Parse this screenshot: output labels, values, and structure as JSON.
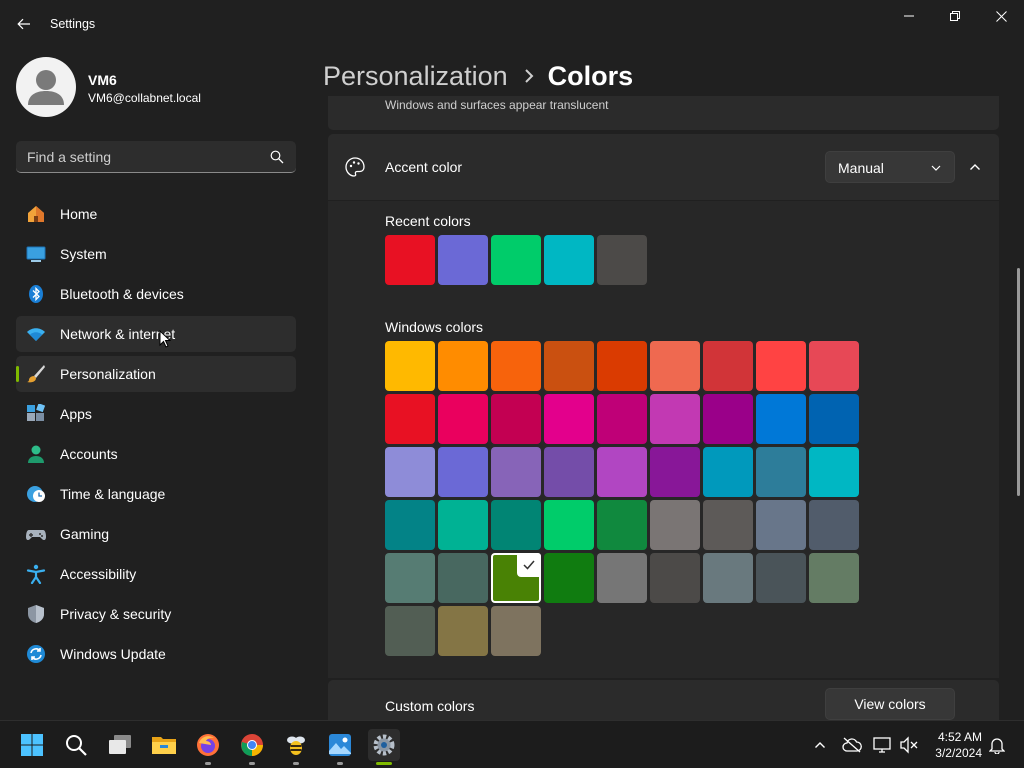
{
  "window": {
    "title": "Settings"
  },
  "user": {
    "name": "VM6",
    "email": "VM6@collabnet.local"
  },
  "search": {
    "placeholder": "Find a setting"
  },
  "nav": {
    "items": [
      {
        "label": "Home",
        "icon": "home-icon"
      },
      {
        "label": "System",
        "icon": "monitor-icon"
      },
      {
        "label": "Bluetooth & devices",
        "icon": "bluetooth-icon"
      },
      {
        "label": "Network & internet",
        "icon": "wifi-icon"
      },
      {
        "label": "Personalization",
        "icon": "paintbrush-icon"
      },
      {
        "label": "Apps",
        "icon": "apps-icon"
      },
      {
        "label": "Accounts",
        "icon": "person-icon"
      },
      {
        "label": "Time & language",
        "icon": "clock-globe-icon"
      },
      {
        "label": "Gaming",
        "icon": "gamepad-icon"
      },
      {
        "label": "Accessibility",
        "icon": "accessibility-icon"
      },
      {
        "label": "Privacy & security",
        "icon": "shield-icon"
      },
      {
        "label": "Windows Update",
        "icon": "update-icon"
      }
    ],
    "active": "Personalization",
    "hovered": "Network & internet"
  },
  "breadcrumb": {
    "parent": "Personalization",
    "current": "Colors"
  },
  "transparency_card": {
    "description": "Windows and surfaces appear translucent"
  },
  "accent": {
    "title": "Accent color",
    "mode": "Manual",
    "recent_label": "Recent colors",
    "recent_colors": [
      "#e81123",
      "#6b69d6",
      "#00cc6a",
      "#00b7c3",
      "#4c4a48"
    ],
    "windows_label": "Windows colors",
    "windows_colors": [
      "#ffb900",
      "#ff8c00",
      "#f7630c",
      "#ca5010",
      "#da3b01",
      "#ef6950",
      "#d13438",
      "#ff4343",
      "#e74856",
      "#e81123",
      "#ea005e",
      "#c30052",
      "#e3008c",
      "#bf0077",
      "#c239b3",
      "#9a0089",
      "#0078d7",
      "#0063b1",
      "#8e8cd8",
      "#6b69d6",
      "#8764b8",
      "#744da9",
      "#b146c2",
      "#881798",
      "#0099bc",
      "#2d7d9a",
      "#00b7c3",
      "#038387",
      "#00b294",
      "#018574",
      "#00cc6a",
      "#10893e",
      "#7a7574",
      "#5d5a58",
      "#68768a",
      "#515c6b",
      "#567c73",
      "#486860",
      "#498205",
      "#107c10",
      "#767676",
      "#4c4a48",
      "#69797e",
      "#4a5459",
      "#647c64",
      "#525e54",
      "#847545",
      "#7e735f"
    ],
    "selected_color": "#498205",
    "custom_label": "Custom colors",
    "view_colors_label": "View colors"
  },
  "taskbar": {
    "apps": [
      "windows-start-icon",
      "search-icon",
      "task-view-icon",
      "file-explorer-icon",
      "firefox-icon",
      "chrome-icon",
      "bee-app-icon",
      "photos-app-icon",
      "settings-icon"
    ],
    "time": "4:52 AM",
    "date": "3/2/2024"
  }
}
